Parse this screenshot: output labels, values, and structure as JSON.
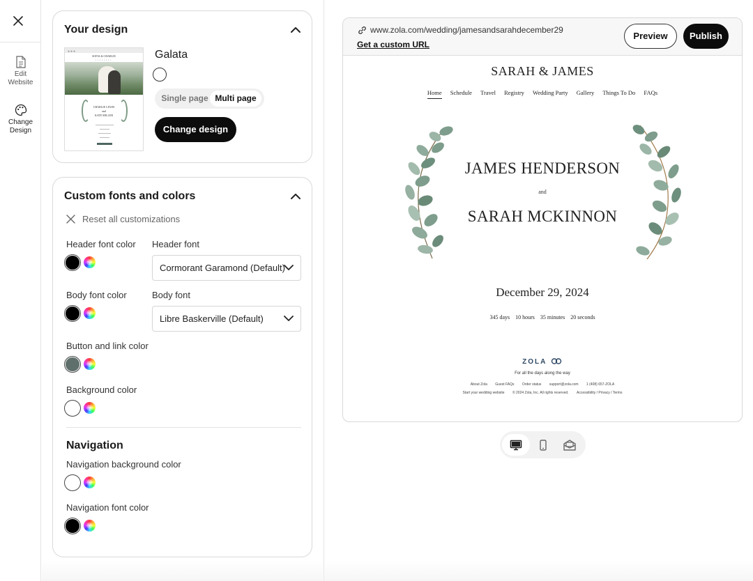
{
  "rail": {
    "edit_label": "Edit\nWebsite",
    "change_label": "Change\nDesign"
  },
  "design_card": {
    "title": "Your design",
    "design_name": "Galata",
    "segments": [
      "Single page",
      "Multi page"
    ],
    "selected_segment": "Multi page",
    "change_button": "Change design",
    "thumb": {
      "names": "SOFIA & CHARLIE",
      "name1": "CHARLIE LEWIS",
      "and": "and",
      "name2": "KATE MILLER"
    }
  },
  "fonts_card": {
    "title": "Custom fonts and colors",
    "reset_label": "Reset all customizations",
    "header_color_label": "Header font color",
    "header_font_label": "Header font",
    "header_font_value": "Cormorant Garamond (Default)",
    "body_color_label": "Body font color",
    "body_font_label": "Body font",
    "body_font_value": "Libre Baskerville (Default)",
    "button_color_label": "Button and link color",
    "background_color_label": "Background color",
    "navigation_title": "Navigation",
    "nav_bg_label": "Navigation background color",
    "nav_font_label": "Navigation font color",
    "colors": {
      "header": "#000000",
      "body": "#000000",
      "button": "#5f6f6c",
      "background": "#ffffff",
      "nav_bg": "#ffffff",
      "nav_font": "#000000"
    }
  },
  "preview": {
    "url": "www.zola.com/wedding/jamesandsarahdecember29",
    "custom_url": "Get a custom URL",
    "preview_button": "Preview",
    "publish_button": "Publish",
    "site_title": "SARAH & JAMES",
    "nav": [
      "Home",
      "Schedule",
      "Travel",
      "Registry",
      "Wedding Party",
      "Gallery",
      "Things To Do",
      "FAQs"
    ],
    "name1": "JAMES HENDERSON",
    "and": "and",
    "name2": "SARAH MCKINNON",
    "date": "December 29, 2024",
    "countdown": {
      "days": "345 days",
      "hours": "10 hours",
      "minutes": "35 minutes",
      "seconds": "20 seconds"
    },
    "footer": {
      "brand": "ZOLA",
      "tagline": "For all the days along the way",
      "links": [
        "About Zola",
        "Guest FAQs",
        "Order status",
        "support@zola.com",
        "1 (408) 657-ZOLA"
      ],
      "links2": [
        "Start your wedding website",
        "© 2024 Zola, Inc. All rights reserved.",
        "Accessibility / Privacy / Terms"
      ]
    }
  },
  "devices": [
    "desktop-icon",
    "mobile-icon",
    "email-icon"
  ]
}
